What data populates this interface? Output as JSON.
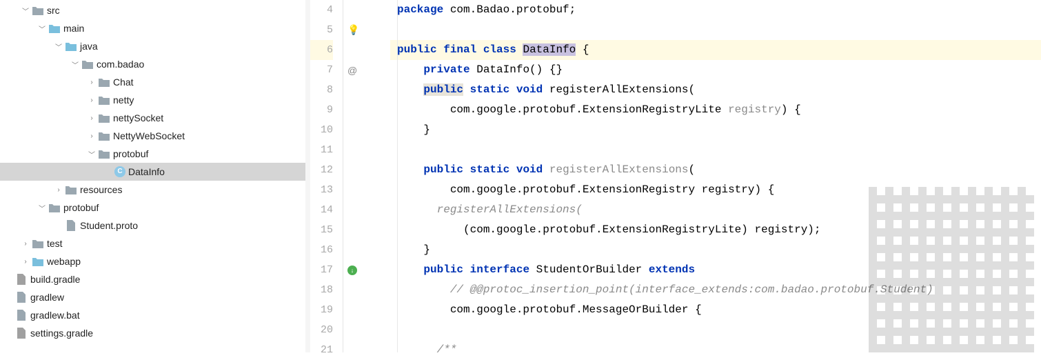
{
  "tree": {
    "nodes": [
      {
        "indent": 0,
        "arrow": "down",
        "icon": "folder-grey",
        "label": "src"
      },
      {
        "indent": 1,
        "arrow": "down",
        "icon": "folder-blue",
        "label": "main"
      },
      {
        "indent": 2,
        "arrow": "down",
        "icon": "folder-blue",
        "label": "java"
      },
      {
        "indent": 3,
        "arrow": "down",
        "icon": "folder-pkg",
        "label": "com.badao"
      },
      {
        "indent": 4,
        "arrow": "right",
        "icon": "folder-pkg",
        "label": "Chat"
      },
      {
        "indent": 4,
        "arrow": "right",
        "icon": "folder-pkg",
        "label": "netty"
      },
      {
        "indent": 4,
        "arrow": "right",
        "icon": "folder-pkg",
        "label": "nettySocket"
      },
      {
        "indent": 4,
        "arrow": "right",
        "icon": "folder-pkg",
        "label": "NettyWebSocket"
      },
      {
        "indent": 4,
        "arrow": "down",
        "icon": "folder-pkg",
        "label": "protobuf"
      },
      {
        "indent": 5,
        "arrow": "none",
        "icon": "file-c",
        "label": "DataInfo",
        "selected": true
      },
      {
        "indent": 2,
        "arrow": "right",
        "icon": "folder-grey",
        "label": "resources"
      },
      {
        "indent": 1,
        "arrow": "down",
        "icon": "folder-grey",
        "label": "protobuf"
      },
      {
        "indent": 2,
        "arrow": "none",
        "icon": "file-generic",
        "label": "Student.proto"
      },
      {
        "indent": 0,
        "arrow": "right",
        "icon": "folder-grey",
        "label": "test"
      },
      {
        "indent": 0,
        "arrow": "right",
        "icon": "folder-blue",
        "label": "webapp"
      },
      {
        "indent": -1,
        "arrow": "none",
        "icon": "file-gradle",
        "label": "build.gradle"
      },
      {
        "indent": -1,
        "arrow": "none",
        "icon": "file-generic",
        "label": "gradlew"
      },
      {
        "indent": -1,
        "arrow": "none",
        "icon": "file-generic",
        "label": "gradlew.bat"
      },
      {
        "indent": -1,
        "arrow": "none",
        "icon": "file-gradle",
        "label": "settings.gradle"
      }
    ]
  },
  "editor": {
    "lines": [
      {
        "n": 4,
        "tokens": [
          [
            "kw",
            "package"
          ],
          [
            "",
            " com.Badao.protobuf;"
          ]
        ]
      },
      {
        "n": 5,
        "bulb": true,
        "tokens": []
      },
      {
        "n": 6,
        "hl": true,
        "tokens": [
          [
            "kw",
            "public"
          ],
          [
            "",
            " "
          ],
          [
            "kw",
            "final"
          ],
          [
            "",
            " "
          ],
          [
            "kw",
            "class"
          ],
          [
            "",
            " "
          ],
          [
            "cls-sel",
            "DataInfo"
          ],
          [
            "",
            " {"
          ]
        ]
      },
      {
        "n": 7,
        "at": true,
        "tokens": [
          [
            "",
            "    "
          ],
          [
            "kw",
            "private"
          ],
          [
            "",
            " DataInfo() {}"
          ]
        ]
      },
      {
        "n": 8,
        "tokens": [
          [
            "",
            "    "
          ],
          [
            "kw-hl",
            "public"
          ],
          [
            "",
            " "
          ],
          [
            "kw",
            "static"
          ],
          [
            "",
            " "
          ],
          [
            "kw",
            "void"
          ],
          [
            "",
            " registerAllExtensions("
          ]
        ]
      },
      {
        "n": 9,
        "tokens": [
          [
            "",
            "        com.google.protobuf.ExtensionRegistryLite "
          ],
          [
            "gray",
            "registry"
          ],
          [
            "",
            ") {"
          ]
        ]
      },
      {
        "n": 10,
        "tokens": [
          [
            "",
            "    }"
          ]
        ]
      },
      {
        "n": 11,
        "tokens": []
      },
      {
        "n": 12,
        "tokens": [
          [
            "",
            "    "
          ],
          [
            "kw",
            "public"
          ],
          [
            "",
            " "
          ],
          [
            "kw",
            "static"
          ],
          [
            "",
            " "
          ],
          [
            "kw",
            "void"
          ],
          [
            "",
            " "
          ],
          [
            "gray",
            "registerAllExtensions"
          ],
          [
            "",
            "("
          ]
        ]
      },
      {
        "n": 13,
        "tokens": [
          [
            "",
            "        com.google.protobuf.ExtensionRegistry registry) {"
          ]
        ]
      },
      {
        "n": 14,
        "tokens": [
          [
            "",
            "      "
          ],
          [
            "cmt",
            "registerAllExtensions("
          ]
        ]
      },
      {
        "n": 15,
        "tokens": [
          [
            "",
            "          (com.google.protobuf.ExtensionRegistryLite) registry);"
          ]
        ]
      },
      {
        "n": 16,
        "tokens": [
          [
            "",
            "    }"
          ]
        ]
      },
      {
        "n": 17,
        "green": true,
        "tokens": [
          [
            "",
            "    "
          ],
          [
            "kw",
            "public"
          ],
          [
            "",
            " "
          ],
          [
            "kw",
            "interface"
          ],
          [
            "",
            " StudentOrBuilder "
          ],
          [
            "kw",
            "extends"
          ]
        ]
      },
      {
        "n": 18,
        "tokens": [
          [
            "",
            "        "
          ],
          [
            "cmt",
            "// @@protoc_insertion_point(interface_extends:com.badao.protobuf.Student)"
          ]
        ]
      },
      {
        "n": 19,
        "tokens": [
          [
            "",
            "        com.google.protobuf.MessageOrBuilder {"
          ]
        ]
      },
      {
        "n": 20,
        "tokens": []
      },
      {
        "n": 21,
        "tokens": [
          [
            "",
            "      "
          ],
          [
            "cmt",
            "/**"
          ]
        ]
      }
    ]
  },
  "icons": {
    "arrow_down": "﹀",
    "arrow_right": "›"
  }
}
